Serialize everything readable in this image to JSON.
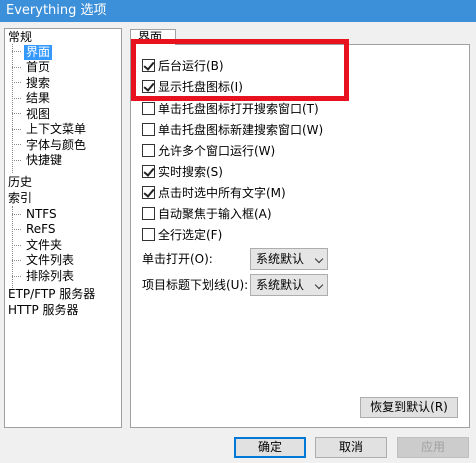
{
  "window": {
    "title": "Everything 选项"
  },
  "tree": {
    "items": [
      {
        "label": "常规",
        "level": 0
      },
      {
        "label": "界面",
        "level": 1,
        "selected": true
      },
      {
        "label": "首页",
        "level": 1
      },
      {
        "label": "搜索",
        "level": 1
      },
      {
        "label": "结果",
        "level": 1
      },
      {
        "label": "视图",
        "level": 1
      },
      {
        "label": "上下文菜单",
        "level": 1
      },
      {
        "label": "字体与颜色",
        "level": 1
      },
      {
        "label": "快捷键",
        "level": 1
      },
      {
        "label": "历史",
        "level": 0
      },
      {
        "label": "索引",
        "level": 0
      },
      {
        "label": "NTFS",
        "level": 1
      },
      {
        "label": "ReFS",
        "level": 1
      },
      {
        "label": "文件夹",
        "level": 1
      },
      {
        "label": "文件列表",
        "level": 1
      },
      {
        "label": "排除列表",
        "level": 1
      },
      {
        "label": "ETP/FTP 服务器",
        "level": 0
      },
      {
        "label": "HTTP 服务器",
        "level": 0
      }
    ]
  },
  "tab": {
    "label": "界面"
  },
  "options": [
    {
      "label": "后台运行(B)",
      "checked": true
    },
    {
      "label": "显示托盘图标(I)",
      "checked": true
    },
    {
      "label": "单击托盘图标打开搜索窗口(T)",
      "checked": false
    },
    {
      "label": "单击托盘图标新建搜索窗口(W)",
      "checked": false
    },
    {
      "label": "允许多个窗口运行(W)",
      "checked": false
    },
    {
      "label": "实时搜索(S)",
      "checked": true
    },
    {
      "label": "点击时选中所有文字(M)",
      "checked": true
    },
    {
      "label": "自动聚焦于输入框(A)",
      "checked": false
    },
    {
      "label": "全行选定(F)",
      "checked": false
    }
  ],
  "fields": {
    "single_click": {
      "label": "单击打开(O):",
      "value": "系统默认"
    },
    "underline": {
      "label": "项目标题下划线(U):",
      "value": "系统默认"
    }
  },
  "buttons": {
    "restore_default": "恢复到默认(R)",
    "ok": "确定",
    "cancel": "取消",
    "apply": "应用"
  },
  "highlight_color": "#e8121e"
}
